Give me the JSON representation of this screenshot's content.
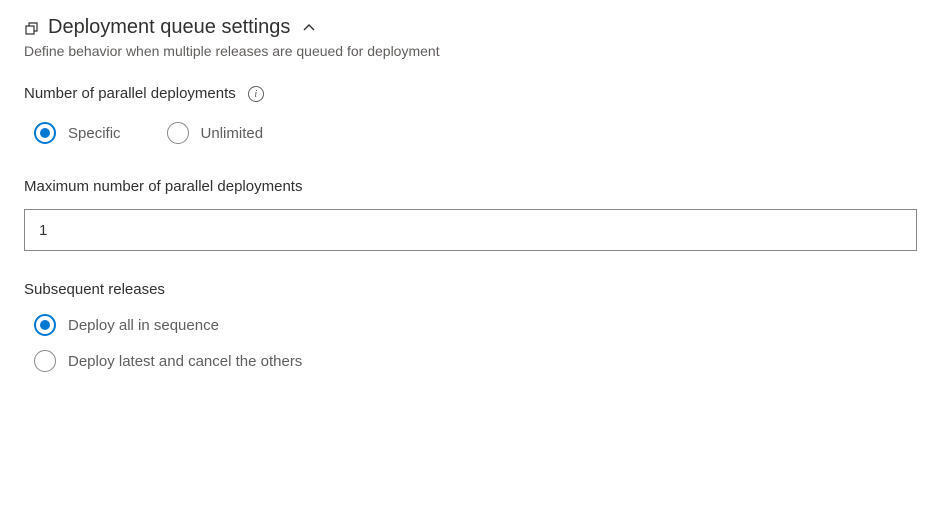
{
  "section": {
    "title": "Deployment queue settings",
    "description": "Define behavior when multiple releases are queued for deployment"
  },
  "parallel": {
    "label": "Number of parallel deployments",
    "options": {
      "specific": "Specific",
      "unlimited": "Unlimited"
    },
    "selected": "specific"
  },
  "max_parallel": {
    "label": "Maximum number of parallel deployments",
    "value": "1"
  },
  "subsequent": {
    "label": "Subsequent releases",
    "options": {
      "sequence": "Deploy all in sequence",
      "cancel": "Deploy latest and cancel the others"
    },
    "selected": "sequence"
  }
}
